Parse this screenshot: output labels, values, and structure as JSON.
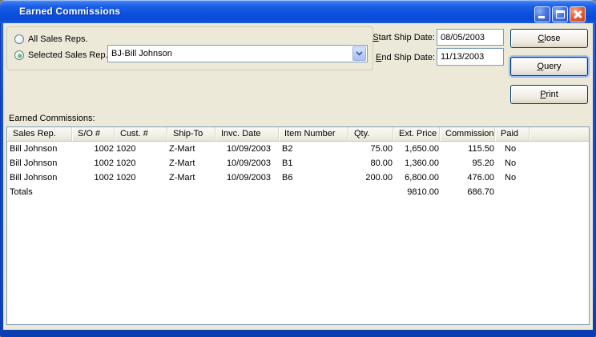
{
  "window": {
    "title": "Earned Commissions"
  },
  "filters": {
    "all_label": "All Sales Reps.",
    "selected_label": "Selected Sales Rep.",
    "selected_value": "BJ-Bill Johnson",
    "start_label": "Start Ship Date:",
    "start_value": "08/05/2003",
    "end_label": "End Ship Date:",
    "end_value": "11/13/2003"
  },
  "actions": {
    "close": "Close",
    "query": "Query",
    "print": "Print"
  },
  "list": {
    "label": "Earned Commissions:",
    "columns": [
      "Sales Rep.",
      "S/O #",
      "Cust. #",
      "Ship-To",
      "Invc. Date",
      "Item Number",
      "Qty.",
      "Ext. Price",
      "Commission",
      "Paid"
    ],
    "rows": [
      [
        "Bill Johnson",
        "1002",
        "1020",
        "Z-Mart",
        "10/09/2003",
        "B2",
        "75.00",
        "1,650.00",
        "115.50",
        "No"
      ],
      [
        "Bill Johnson",
        "1002",
        "1020",
        "Z-Mart",
        "10/09/2003",
        "B1",
        "80.00",
        "1,360.00",
        "95.20",
        "No"
      ],
      [
        "Bill Johnson",
        "1002",
        "1020",
        "Z-Mart",
        "10/09/2003",
        "B6",
        "200.00",
        "6,800.00",
        "476.00",
        "No"
      ]
    ],
    "totals_row": [
      "Totals",
      "",
      "",
      "",
      "",
      "",
      "",
      "9810.00",
      "686.70",
      ""
    ]
  },
  "colors": {
    "titlebar_blue": "#0D52DE",
    "frame_blue": "#1450D0",
    "dialog_bg": "#ECE9D8",
    "field_border": "#7F9DB9",
    "close_red": "#C8421A",
    "radio_green": "#2DA02D"
  }
}
